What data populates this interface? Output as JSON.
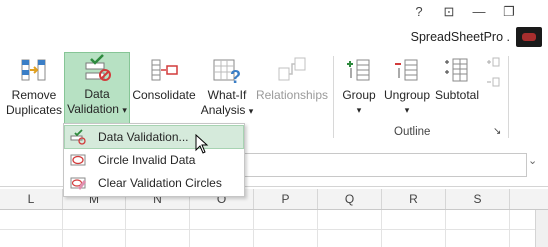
{
  "window": {
    "help": "?",
    "ribbon_toggle": "⊡",
    "minimize": "—",
    "restore": "❐"
  },
  "account": {
    "name": "SpreadSheetPro ."
  },
  "ribbon": {
    "remove_duplicates": {
      "line1": "Remove",
      "line2": "Duplicates"
    },
    "data_validation": {
      "line1": "Data",
      "line2": "Validation",
      "caret": "▾"
    },
    "consolidate": {
      "label": "Consolidate"
    },
    "what_if": {
      "line1": "What-If",
      "line2": "Analysis",
      "caret": "▾"
    },
    "relationships": {
      "label": "Relationships"
    },
    "group": {
      "label": "Group",
      "caret": "▾"
    },
    "ungroup": {
      "label": "Ungroup",
      "caret": "▾"
    },
    "subtotal": {
      "label": "Subtotal"
    },
    "outline_label": "Outline",
    "launcher": "↘"
  },
  "menu": {
    "items": [
      {
        "label": "Data Validation..."
      },
      {
        "label": "Circle Invalid Data"
      },
      {
        "label": "Clear Validation Circles"
      }
    ]
  },
  "formula": {
    "dropdown": "⌄"
  },
  "columns": [
    "L",
    "M",
    "N",
    "O",
    "P",
    "Q",
    "R",
    "S"
  ],
  "colors": {
    "accent": "#217346",
    "active_button": "#b7e1c3",
    "menu_hover": "#d5eadb"
  }
}
